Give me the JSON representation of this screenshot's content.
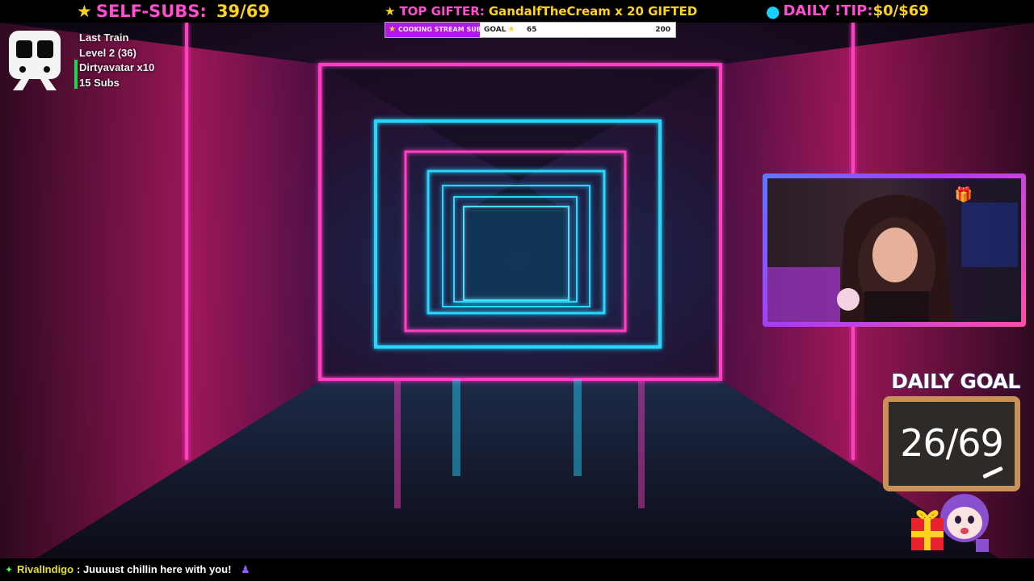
{
  "topbar": {
    "self_subs": {
      "label": "SELF-SUBS:",
      "value": "39/69"
    },
    "top_gifter": {
      "label": "TOP GIFTER:",
      "value": "GandalfTheCream x 20 GIFTED"
    },
    "daily_tip": {
      "label": "DAILY !TIP:",
      "value": "$0/$69"
    }
  },
  "goal_bar": {
    "label": "COOKING STREAM SUB",
    "word": "GOAL",
    "current": "65",
    "max": "200",
    "progress": 0.325
  },
  "train": {
    "title": "Last Train",
    "level": "Level 2  (36)",
    "top": "Dirtyavatar x10",
    "subs": "15 Subs"
  },
  "daily_goal": {
    "title": "DAILY GOAL",
    "value": "26/69"
  },
  "chat": {
    "user": "RivalIndigo",
    "message": ": Juuuust chillin here with you!"
  },
  "colors": {
    "pink": "#ff4fd0",
    "gold": "#ffd21e",
    "cyan": "#19d1ff",
    "goal_purple": "#b416e8",
    "train_green": "#23d44f"
  },
  "icons": [
    "star-icon",
    "piggy-bank-icon",
    "train-icon",
    "gift-icon",
    "chalk-icon",
    "sparkle-icon",
    "emote-icon"
  ]
}
